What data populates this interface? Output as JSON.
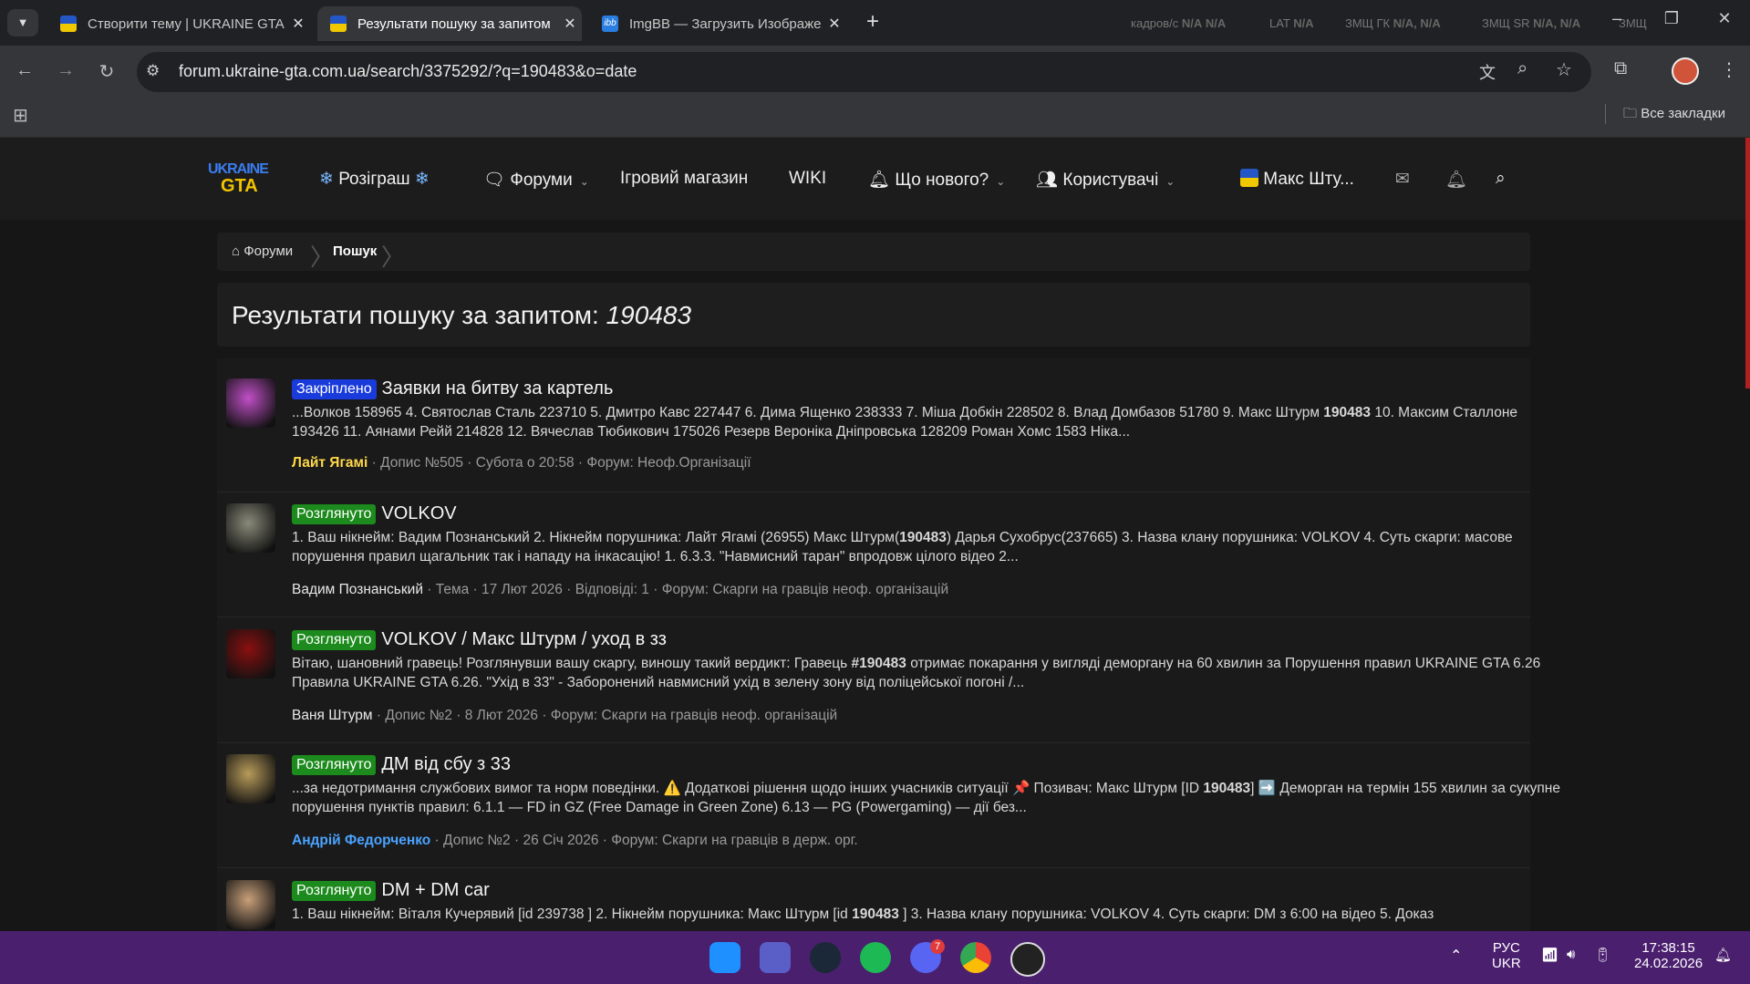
{
  "browser": {
    "tabs": [
      {
        "title": "Створити тему | UKRAINE GTA",
        "active": false
      },
      {
        "title": "Результати пошуку за запитом",
        "active": true
      },
      {
        "title": "ImgBB — Загрузить Изображе...",
        "active": false
      }
    ],
    "new_tab": "+",
    "url": "forum.ukraine-gta.com.ua/search/3375292/?q=190483&o=date",
    "bookmarks_label": "Все закладки",
    "hud": [
      {
        "label": "кадров/с",
        "v1": "N/A",
        "v2": "N/A"
      },
      {
        "label": "LAT",
        "v1": "N/A",
        "v2": ""
      },
      {
        "label": "ЗМЩ ГК",
        "v1": "N/A,",
        "v2": "N/A"
      },
      {
        "label": "ЗМЩ SR",
        "v1": "N/A,",
        "v2": "N/A"
      },
      {
        "label": "ЗМЩ",
        "v1": "",
        "v2": ""
      }
    ]
  },
  "site": {
    "logo_top": "UKRAINE",
    "logo_bottom": "GTA",
    "nav": {
      "giveaway": "Розіграш",
      "forums": "Форуми",
      "shop": "Ігровий магазин",
      "wiki": "WIKI",
      "whats_new": "Що нового?",
      "users": "Користувачі",
      "account": "Макс Шту..."
    }
  },
  "breadcrumb": {
    "home": "Форуми",
    "current": "Пошук"
  },
  "page": {
    "title_prefix": "Результати пошуку за запитом:",
    "query": "190483"
  },
  "results": [
    {
      "badge": "Закріплено",
      "badge_color": "#1a3bdb",
      "title": "Заявки на битву за картель",
      "snippet_html": "...Волков 158965 4. Святослав Сталь 223710 5. Дмитро Кавс 227447 6. Дима Ященко 238333 7. Міша Добкін 228502 8. Влад Домбазов 51780 9. Макс Штурм <b>190483</b> 10. Максим Сталлоне 193426 11. Аянами Рейй 214828 12. Вячеслав Тюбикович 175026 Резерв Вероніка Дніпровська 128209 Роман Хомс 1583 Ніка...",
      "author": "Лайт Ягамі",
      "author_color": "#ffd84a",
      "meta": " · Допис №505 · Субота о 20:58 · Форум: Неоф.Організації",
      "avatar": "#c04fc7"
    },
    {
      "badge": "Розглянуто",
      "badge_color": "#1c8a1c",
      "title": "VOLKOV",
      "snippet_html": "1. Ваш нікнейм: Вадим Познанський 2. Нікнейм порушника: Лайт Ягамі (26955) Макс Штурм(<b>190483</b>) Дарья Сухобрус(237665) 3. Назва клану порушника: VOLKOV 4. Суть скарги: масове порушення правил щагальник так і нападу на інкасацію! 1. 6.3.3. \"Навмисний таран\" впродовж цілого відео 2...",
      "author": "Вадим Познанський",
      "author_color": "#e8e8e8",
      "meta": " · Тема · 17 Лют 2026 · Відповіді: 1 · Форум: Скарги на гравців неоф. організацій",
      "avatar": "#8a8a7a"
    },
    {
      "badge": "Розглянуто",
      "badge_color": "#1c8a1c",
      "title": "VOLKOV / Макс Штурм / уход в зз",
      "snippet_html": "Вітаю, шановний гравець! Розглянувши вашу скаргу, виношу такий вердикт: Гравець <b>#190483</b> отримає покарання у вигляді деморгану на 60 хвилин за Порушення правил UKRAINE GTA 6.26 Правила UKRAINE GTA 6.26. \"Ухід в 33\" - Заборонений навмисний ухід в зелену зону від поліцейської погоні /...",
      "author": "Ваня Штурм",
      "author_color": "#e8e8e8",
      "meta": " · Допис №2 · 8 Лют 2026 · Форум: Скарги на гравців неоф. організацій",
      "avatar": "#8a1010"
    },
    {
      "badge": "Розглянуто",
      "badge_color": "#1c8a1c",
      "title": "ДМ від сбу з 33",
      "snippet_html": "...за недотримання службових вимог та норм поведінки. ⚠️ Додаткові рішення щодо інших учасників ситуації 📌 Позивач: Макс Штурм [ID <b>190483</b>] ➡️ Деморган на термін 155 хвилин за сукупне порушення пунктів правил: 6.1.1 — FD in GZ (Free Damage in Green Zone) 6.13 — PG (Powergaming) — дії без...",
      "author": "Андрій Федорченко",
      "author_color": "#4aa3ff",
      "meta": " · Допис №2 · 26 Січ 2026 · Форум: Скарги на гравців в держ. орг.",
      "avatar": "#b89b5a"
    },
    {
      "badge": "Розглянуто",
      "badge_color": "#1c8a1c",
      "title": "DM + DM car",
      "snippet_html": "1. Ваш нікнейм: Віталя Кучерявий [id 239738 ] 2. Нікнейм порушника: Макс Штурм [id <b>190483</b> ] 3. Назва клану порушника: VOLKOV 4. Суть скарги: DM з 6:00 на відео 5. Доказ",
      "author": "",
      "author_color": "#e8e8e8",
      "meta": "",
      "avatar": "#c9a07a"
    }
  ],
  "taskbar": {
    "lang_top": "РУС",
    "lang_bottom": "UKR",
    "time": "17:38:15",
    "date": "24.02.2026",
    "discord_badge": "7"
  }
}
